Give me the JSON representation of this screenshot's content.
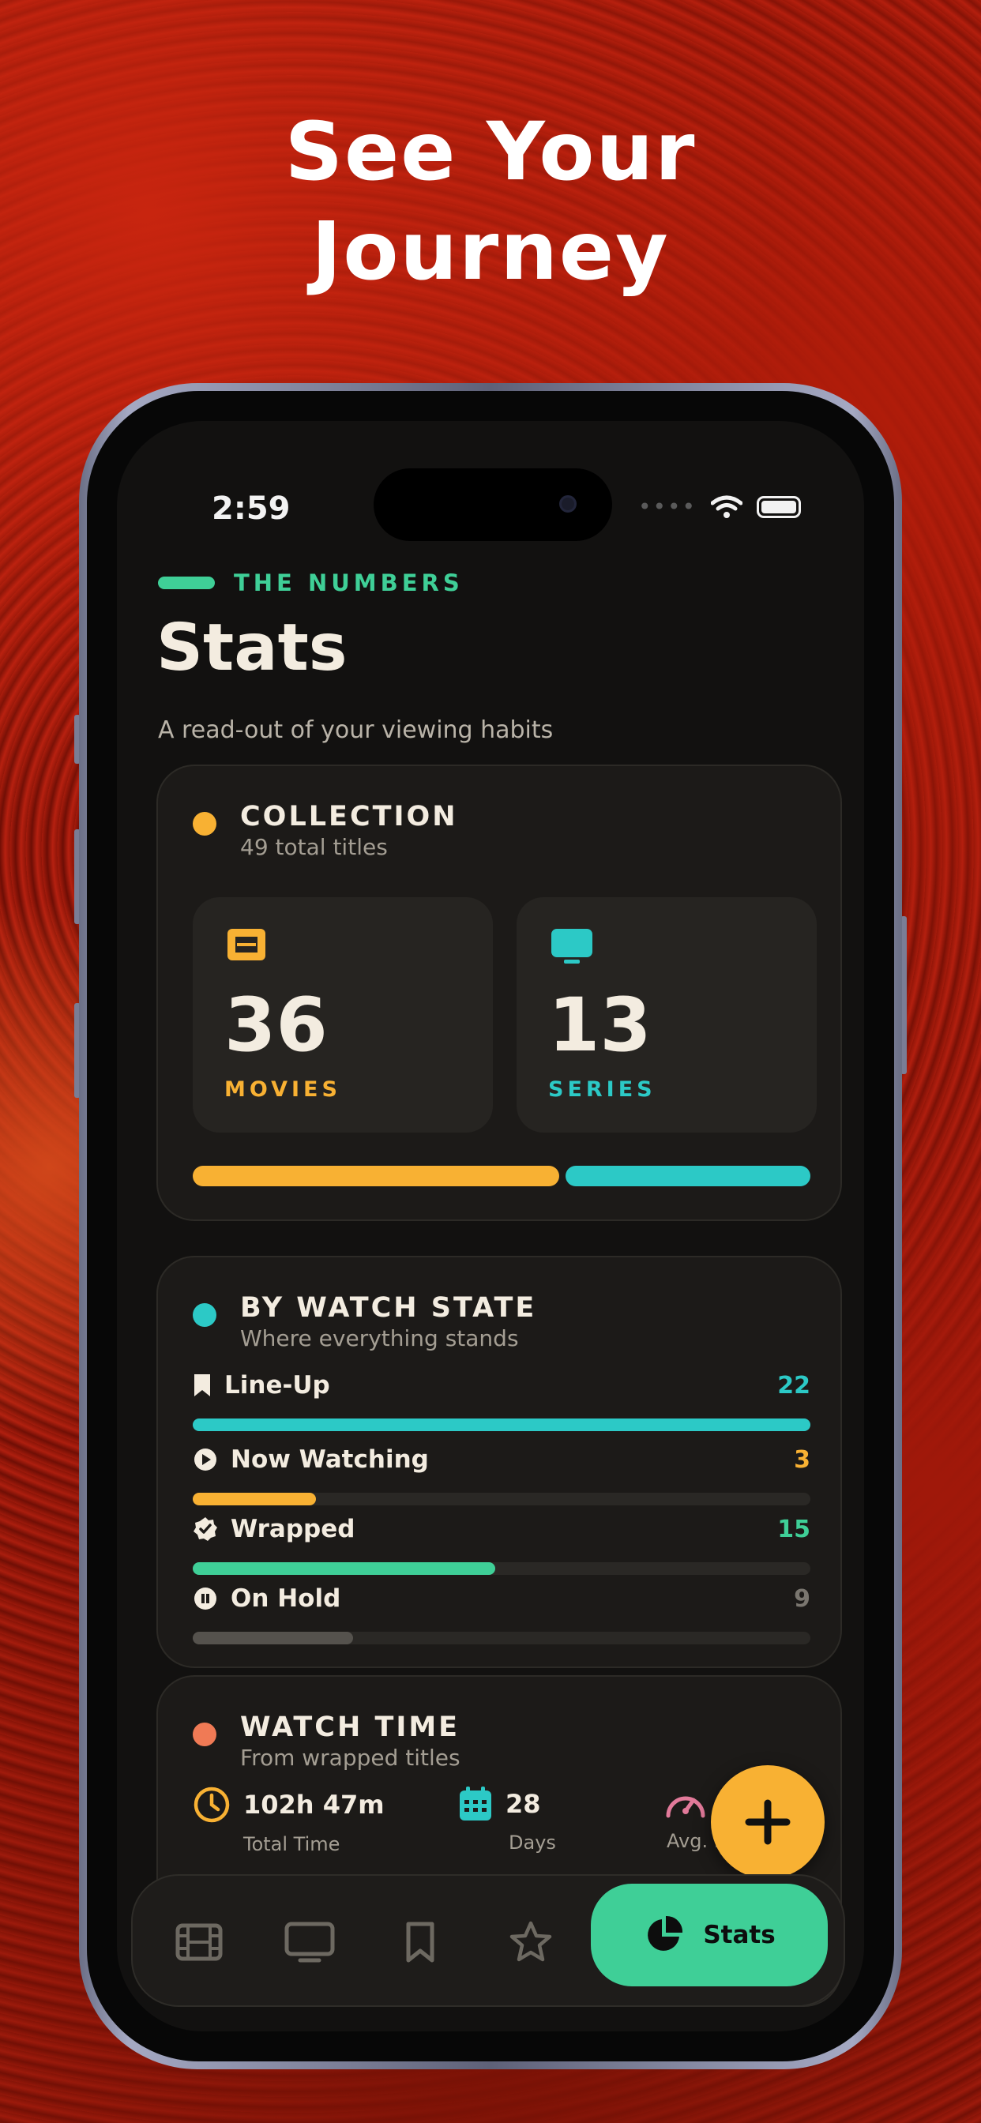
{
  "promo": {
    "line1": "See Your",
    "line2": "Journey"
  },
  "status_bar": {
    "time": "2:59",
    "dots": "••••"
  },
  "header": {
    "eyebrow": "THE NUMBERS",
    "title": "Stats",
    "subtitle": "A read-out of your viewing habits"
  },
  "collection": {
    "title": "COLLECTION",
    "subtitle": "49 total titles",
    "movies": {
      "count": "36",
      "label": "MOVIES"
    },
    "series": {
      "count": "13",
      "label": "SERIES"
    },
    "split": {
      "movies_fraction": 0.6,
      "series_fraction": 0.4
    }
  },
  "watch_state": {
    "title": "BY WATCH STATE",
    "subtitle": "Where everything stands",
    "rows": [
      {
        "label": "Line-Up",
        "count": "22",
        "fraction": 1.0,
        "color": "#2cc9c6",
        "icon": "bookmark-icon"
      },
      {
        "label": "Now Watching",
        "count": "3",
        "fraction": 0.2,
        "color": "#f8b133",
        "icon": "play-circle-icon"
      },
      {
        "label": "Wrapped",
        "count": "15",
        "fraction": 0.49,
        "color": "#3fcf97",
        "icon": "check-badge-icon"
      },
      {
        "label": "On Hold",
        "count": "9",
        "fraction": 0.26,
        "color": "#55524d",
        "icon": "pause-circle-icon"
      }
    ]
  },
  "watch_time": {
    "title": "WATCH TIME",
    "subtitle": "From wrapped titles",
    "items": [
      {
        "value": "102h 47m",
        "label": "Total Time",
        "icon": "clock-icon"
      },
      {
        "value": "28",
        "label": "Days",
        "icon": "calendar-icon"
      },
      {
        "value": "",
        "label": "Avg. R",
        "icon": "speedometer-icon"
      }
    ]
  },
  "tab_bar": {
    "tabs": [
      {
        "name": "movies",
        "icon": "film-icon"
      },
      {
        "name": "series",
        "icon": "tv-icon"
      },
      {
        "name": "lineup",
        "icon": "bookmark-icon"
      },
      {
        "name": "favorites",
        "icon": "star-icon"
      }
    ],
    "active_label": "Stats",
    "active_icon": "pie-chart-icon"
  },
  "fab": {
    "icon": "plus-icon"
  },
  "colors": {
    "accent_green": "#3fcf97",
    "accent_amber": "#f8b133",
    "accent_teal": "#2cc9c6",
    "accent_coral": "#f07a55",
    "accent_pink": "#e27a9a"
  }
}
